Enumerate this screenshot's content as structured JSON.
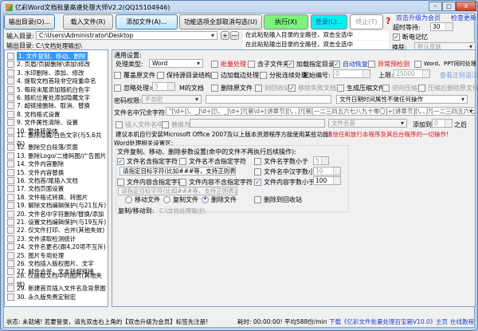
{
  "window": {
    "title": "亿彩Word文档批量高速处理大师V2.2(QQ15104946)"
  },
  "toolbar": {
    "output_dir": "输出目录(O)...",
    "load_file": "载入文件(R)",
    "add_file": "添加文件(A)...",
    "uncheck_all": "功能选项全部取消勾选(U)",
    "execute": "执行(X)",
    "login": "登录(L)...",
    "stop": "终止(T)",
    "help": "?"
  },
  "top_right": {
    "upgrade": "双击升级为会员",
    "check_update": "检查更新",
    "timeout_label": "超时等待:",
    "timeout_value": "30",
    "power_memory": "断电记忆",
    "skin_label": "换肤:",
    "skin_value": "默认皮肤"
  },
  "paths": {
    "input_label": "输入目录:",
    "input_value": "C:\\Users\\Administrator\\Desktop",
    "plus": "+",
    "minus": "—",
    "input_paste": "在此粘贴输入目录的全路径，双击全选中",
    "output_label": "输出目录:",
    "output_value": "C:\\文档处理输出\\",
    "output_paste": "在此粘贴输出目录的全路径，双击全选中"
  },
  "functions": [
    "1. 文件复制、移动、删除",
    "2. 页眉/页脚删除\\添加\\修改",
    "3. 水印删除、添加、修改",
    "4. 提取文档首段非空段重命名",
    "5. 每段末尾添加随机白色字",
    "6. 随机位置处添加隐藏文字",
    "7. 超链接删除、取消、替换",
    "8. 文档格式设置",
    "9. 文件属性清除、设置",
    "10. 繁体转简体",
    "11. 删除隐藏/白色文字(与5,6共存)",
    "12. 删除空白段落/页面",
    "13. 删除Logo/二维码图/广告图片",
    "14. 文件内容删除",
    "15. 文件内容替换",
    "16. 文档首/尾插入文档",
    "17. 文档页面设置",
    "18. 文件格式转换、转图片",
    "19. 解除文档编辑保护(与21互斥)",
    "20. 文件名中字符删除/替换/添加",
    "21. 设置文档编辑保护(与19互斥)",
    "22. 仅文件打印、合并(其他失效)",
    "23. 文件读取检测统计",
    "24. 文件名更名(跟4,20项不互斥)",
    "25. 图片专用处理",
    "26. 文档插入版权图片、文字",
    "27. 邮件合并，文本转超链接",
    "28. 仅提取文档中的图片(其他失效)",
    "29. 新建首页插入文件名及背景图",
    "30. 永久版免费定制宏"
  ],
  "general": {
    "title": "通用设置:",
    "type_label": "处理类型:",
    "type_value": "Word",
    "batch": "批量处理",
    "subfolders": "含子文件夹",
    "load_dir": "加载指定目录",
    "auto_restore": "自动恢复",
    "precheck": "异常预检测",
    "word_ppt": "Word、PPT同时处理",
    "overwrite": "覆盖原文件",
    "keep_structure": "保持源目录结构",
    "load_process": "边加载边处理",
    "batch_continuous": "分批连续处理",
    "start_no_label": "起始编号:",
    "start_no": "0",
    "limit_label": "上限:",
    "limit": "25000",
    "regex_help": "查看正则语法",
    "ignore": "忽略处理>=",
    "ignore_value": "5",
    "ignore_suffix": "M的文档",
    "delete_original": "删除原文件",
    "to_recycle": "到回收站",
    "remove_failed": "移除失败文档",
    "gen_zip": "生成压缩文件",
    "reverse_zip": "逆向压缩",
    "zip_delete": "压缩后删除原文件",
    "password_label": "密码权限:",
    "password_value": "不加密",
    "date_option": "文件日期时间属性不做任何操作",
    "redundant_label": "文件名中冗余字符:",
    "redundant_value": "\"[\\d+[\\、_]\\d+[[\\、_]\\d+]?[第\\d+[讲章节][\\、、]?[第[一二三四五六七八九十零〇]+[讲章节][\\、、]?[一二三四五六七八九十零",
    "insert_name": "插入文件名中",
    "replace_with": "替换为",
    "position_value": "文件名首",
    "add_to": "添加到",
    "add_to_value": "0",
    "after": "之后",
    "advice": "建议本机自行安装Microsoft Office 2007及以上版本资源程序方能使用某些功能!",
    "trust": "请信任和放行本程序及其后台程序的一切操作!"
  },
  "word": {
    "title": "Word处理相关设置区:",
    "group_title": "文件复制、移动、删除参数设置(命中的文件不再执行后续操作):",
    "name_contains": "文件名含指定字符",
    "name_not_contains": "文件名不含指定字符",
    "name_len_lt": "文件名字数小于",
    "name_len_value": "5",
    "name_target": "请指定目标字符(比如###等，支持正则表达式)",
    "cn_len_lt": "文件名中汉字数小于",
    "cn_len_value": "10",
    "content_contains": "文件内容含指定字符",
    "content_not_contains": "文件内容不含指定字符",
    "content_len_lt": "文件内容字数小于",
    "content_len_value": "100",
    "content_target": "请指定目标字符(比如###等，支持正则表达式)",
    "move": "移动文件",
    "copy": "复制文件",
    "delete": "删除文件",
    "delete_recycle": "删除到回收站",
    "dest_label": "复制/移动到:",
    "dest_value": "C:\\文档处理输出\\"
  },
  "status": {
    "text": "状态: 未就绪! 若要登录，请先双击右上角的【双击升级为会员】标签先注册!",
    "elapsed": "耗时: 00:00:00! 平均588份/min",
    "download": "下载《亿彩文件批量处理百宝箱V10.0》",
    "home": "主页",
    "tutorial": "在线教程"
  }
}
